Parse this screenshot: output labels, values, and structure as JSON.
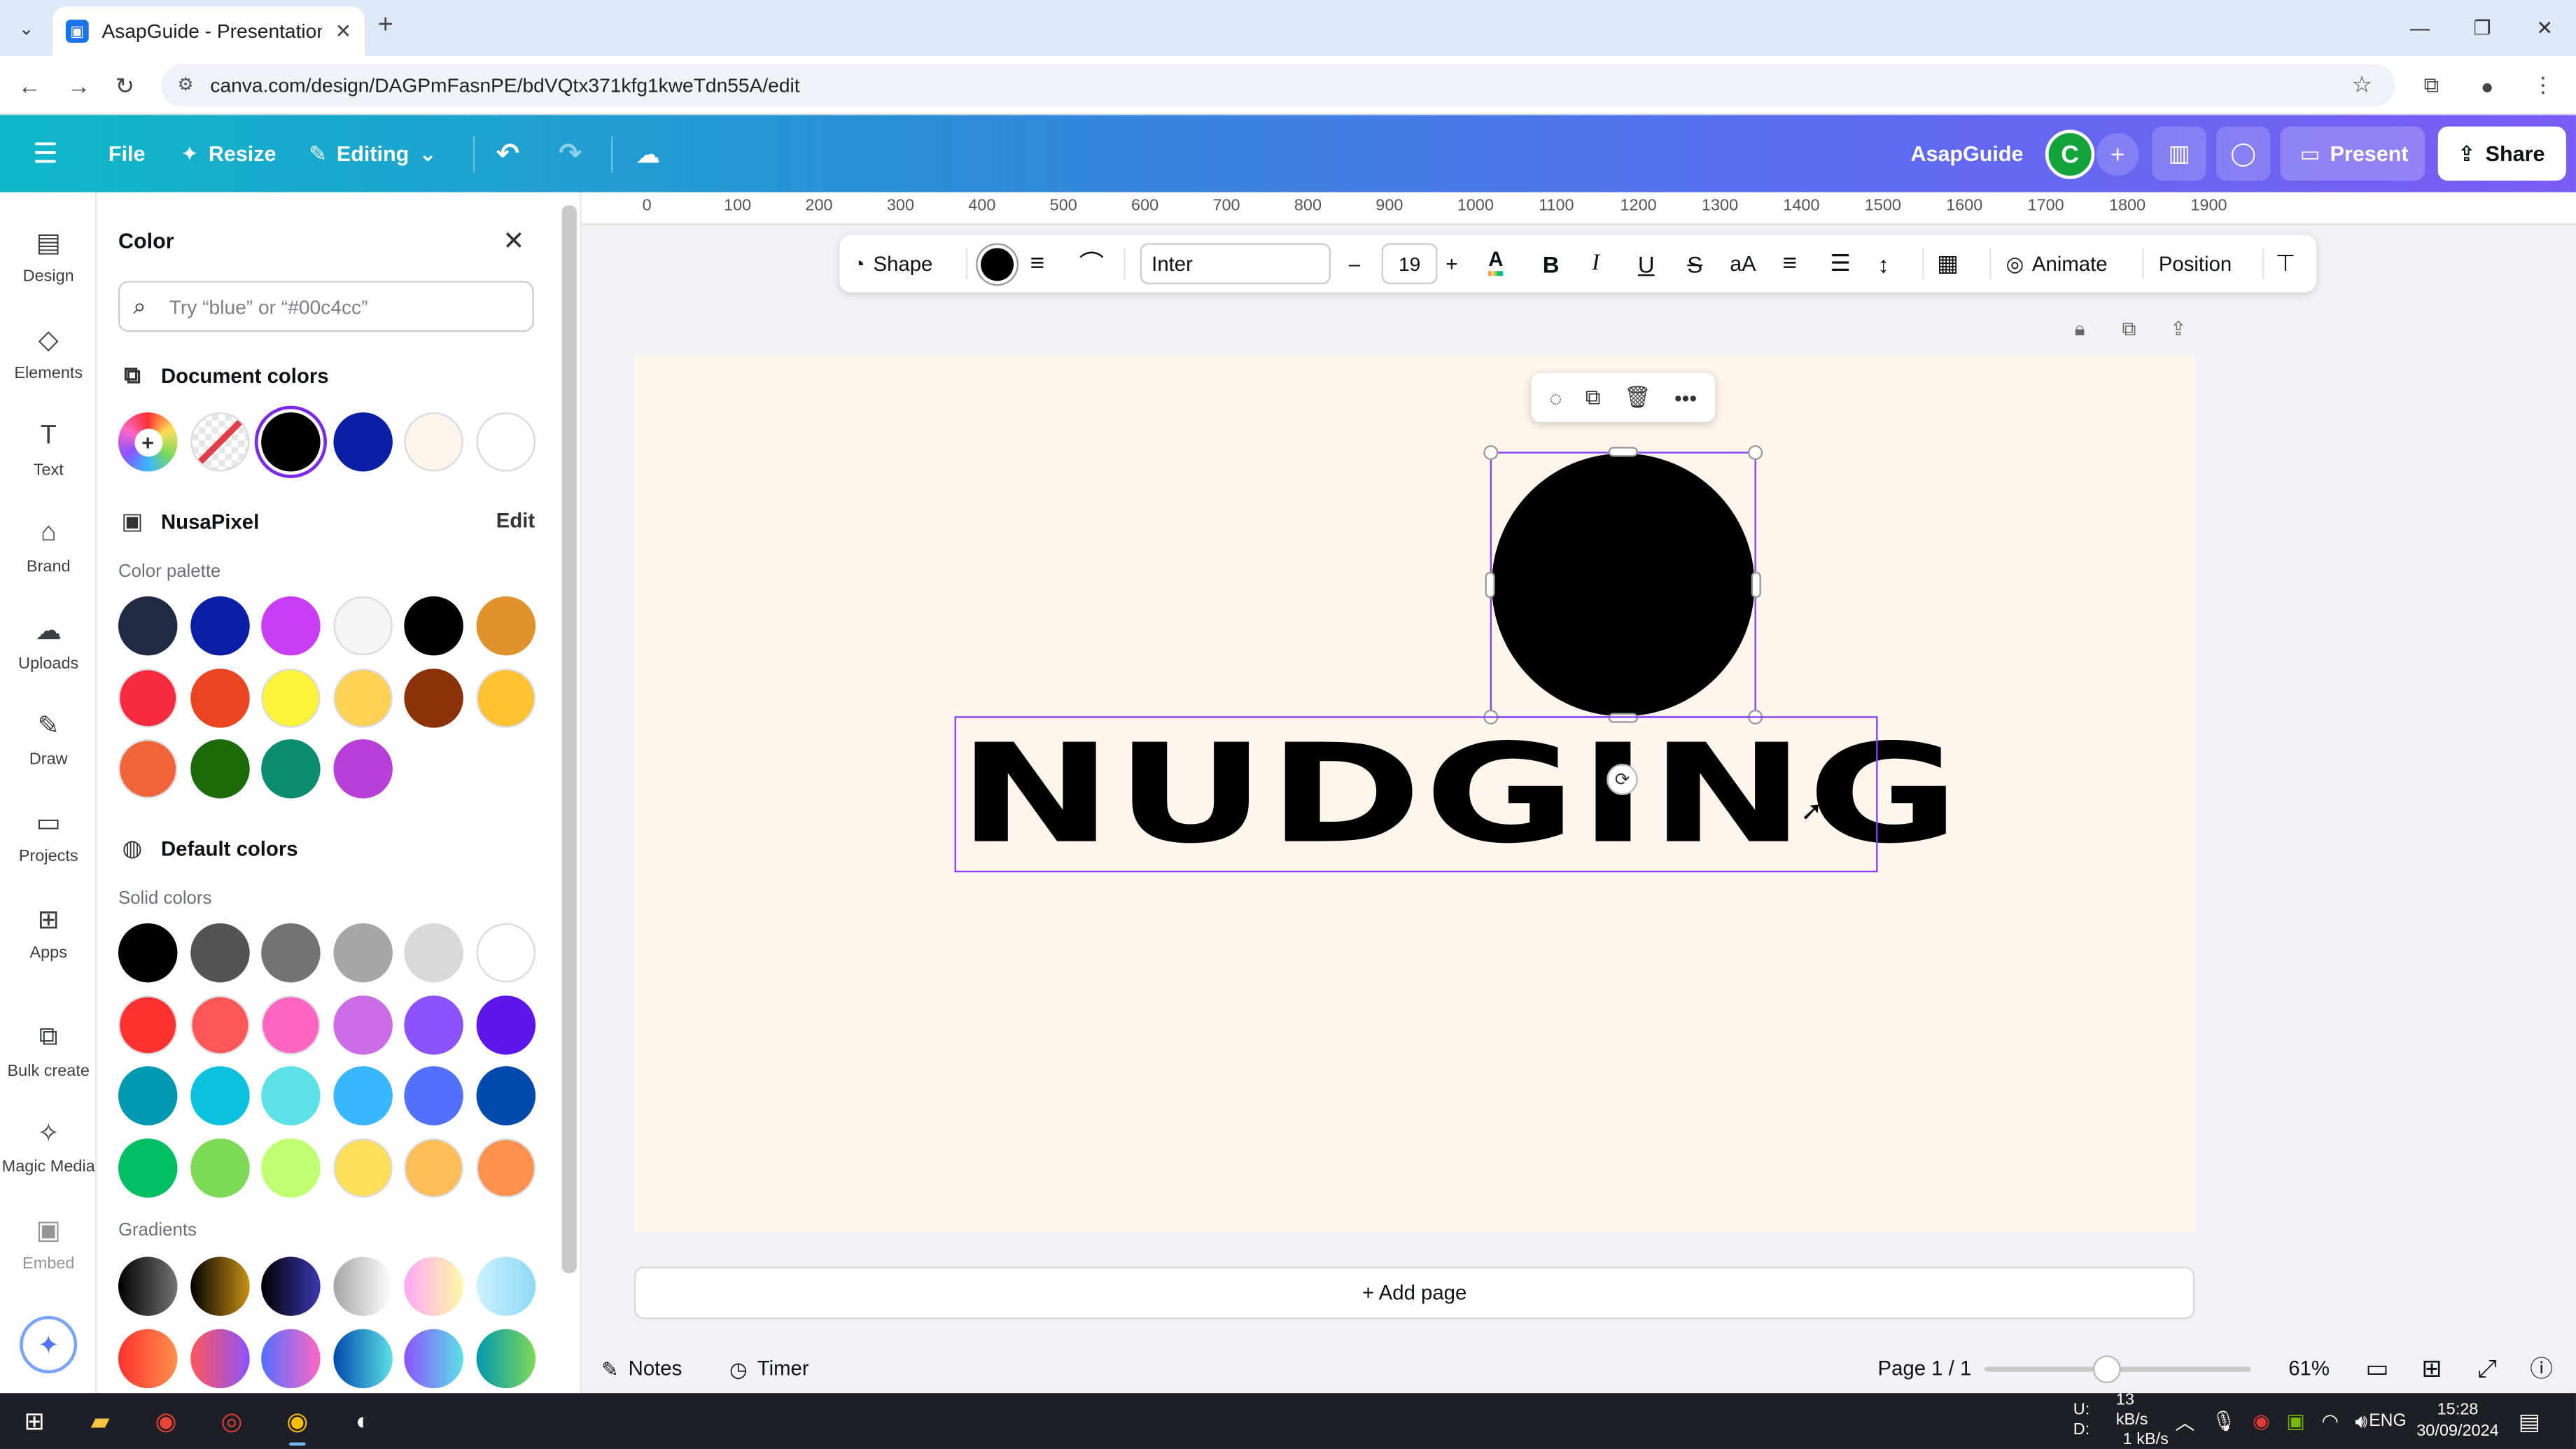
{
  "browser": {
    "tab_title": "AsapGuide - Presentation",
    "url": "canva.com/design/DAGPmFasnPE/bdVQtx371kfg1kweTdn55A/edit"
  },
  "header": {
    "file": "File",
    "resize": "Resize",
    "editing": "Editing",
    "team": "AsapGuide",
    "avatar_letter": "C",
    "present": "Present",
    "share": "Share"
  },
  "rail": [
    {
      "label": "Design",
      "icon": "design-icon",
      "glyph": "▤"
    },
    {
      "label": "Elements",
      "icon": "elements-icon",
      "glyph": "◇"
    },
    {
      "label": "Text",
      "icon": "text-icon",
      "glyph": "T"
    },
    {
      "label": "Brand",
      "icon": "brand-icon",
      "glyph": "⌂"
    },
    {
      "label": "Uploads",
      "icon": "uploads-icon",
      "glyph": "☁"
    },
    {
      "label": "Draw",
      "icon": "draw-icon",
      "glyph": "✎"
    },
    {
      "label": "Projects",
      "icon": "projects-icon",
      "glyph": "▭"
    },
    {
      "label": "Apps",
      "icon": "apps-icon",
      "glyph": "⊞"
    },
    {
      "label": "Bulk create",
      "icon": "bulk-create-icon",
      "glyph": "⧉"
    },
    {
      "label": "Magic Media",
      "icon": "magic-media-icon",
      "glyph": "✧"
    },
    {
      "label": "Embed",
      "icon": "embed-icon",
      "glyph": "▣"
    }
  ],
  "panel": {
    "title": "Color",
    "search_placeholder": "Try “blue” or “#00c4cc”",
    "document_colors_label": "Document colors",
    "brand_name": "NusaPixel",
    "edit_label": "Edit",
    "palette_label": "Color palette",
    "default_colors_label": "Default colors",
    "solid_label": "Solid colors",
    "gradients_label": "Gradients",
    "document_colors": [
      "transparent",
      "#000000",
      "#0a1fa6",
      "#fdf5eb",
      "#ffffff"
    ],
    "selected_document_color": "#000000",
    "palette": [
      [
        "#1f2a44",
        "#0a1fa6",
        "#c93ef5",
        "#f5f5f5",
        "#000000",
        "#e0932c"
      ],
      [
        "#f52a3e",
        "#ea4521",
        "#fbf339",
        "#fdd153",
        "#8c320a",
        "#ffc232"
      ],
      [
        "#f2643a",
        "#1d6a0b",
        "#0b8c6f",
        "#b83ed8"
      ]
    ],
    "solid_colors": [
      [
        "#000000",
        "#545454",
        "#737373",
        "#a6a6a6",
        "#d9d9d9",
        "#ffffff"
      ],
      [
        "#ff3131",
        "#ff5757",
        "#ff66c4",
        "#cb6ce6",
        "#8c52ff",
        "#5e17eb"
      ],
      [
        "#0097b2",
        "#0cc0df",
        "#5ce1e6",
        "#38b6ff",
        "#5271ff",
        "#004aad"
      ],
      [
        "#00bf63",
        "#7ed957",
        "#c1ff72",
        "#ffde59",
        "#ffbd59",
        "#ff914d"
      ]
    ],
    "gradients": [
      [
        "linear-gradient(90deg,#000,#737373)",
        "linear-gradient(90deg,#000,#c89116)",
        "linear-gradient(90deg,#000,#3b38b1)",
        "linear-gradient(90deg,#a6a6a6,#fff)",
        "linear-gradient(90deg,#ffa8f8,#fff9a6)",
        "linear-gradient(90deg,#ccf2ff,#8ed8f7)"
      ],
      [
        "linear-gradient(90deg,#ff3131,#ff914d)",
        "linear-gradient(90deg,#ff5757,#8c52ff)",
        "linear-gradient(90deg,#5170ff,#ff66c4)",
        "linear-gradient(90deg,#004aad,#5de0e6)",
        "linear-gradient(90deg,#8c52ff,#5ce1e6)",
        "linear-gradient(90deg,#0097b2,#7ed957)"
      ]
    ]
  },
  "ruler": [
    "0",
    "100",
    "200",
    "300",
    "400",
    "500",
    "600",
    "700",
    "800",
    "900",
    "1000",
    "1100",
    "1200",
    "1300",
    "1400",
    "1500",
    "1600",
    "1700",
    "1800",
    "1900"
  ],
  "toolbar": {
    "shape": "Shape",
    "font": "Inter",
    "size": "19",
    "animate": "Animate",
    "position": "Position"
  },
  "canvas": {
    "text": "NUDGING",
    "add_page": "+ Add page"
  },
  "bottom": {
    "notes": "Notes",
    "timer": "Timer",
    "page": "Page 1 / 1",
    "zoom": "61%"
  },
  "taskbar": {
    "net_up_label": "U:",
    "net_down_label": "D:",
    "net_up": "13 kB/s",
    "net_down": "1 kB/s",
    "lang": "ENG",
    "time": "15:28",
    "date": "30/09/2024"
  },
  "colors": {
    "accent": "#8b3dff",
    "header_start": "#0fb8c9",
    "header_end": "#7b5cf2"
  }
}
